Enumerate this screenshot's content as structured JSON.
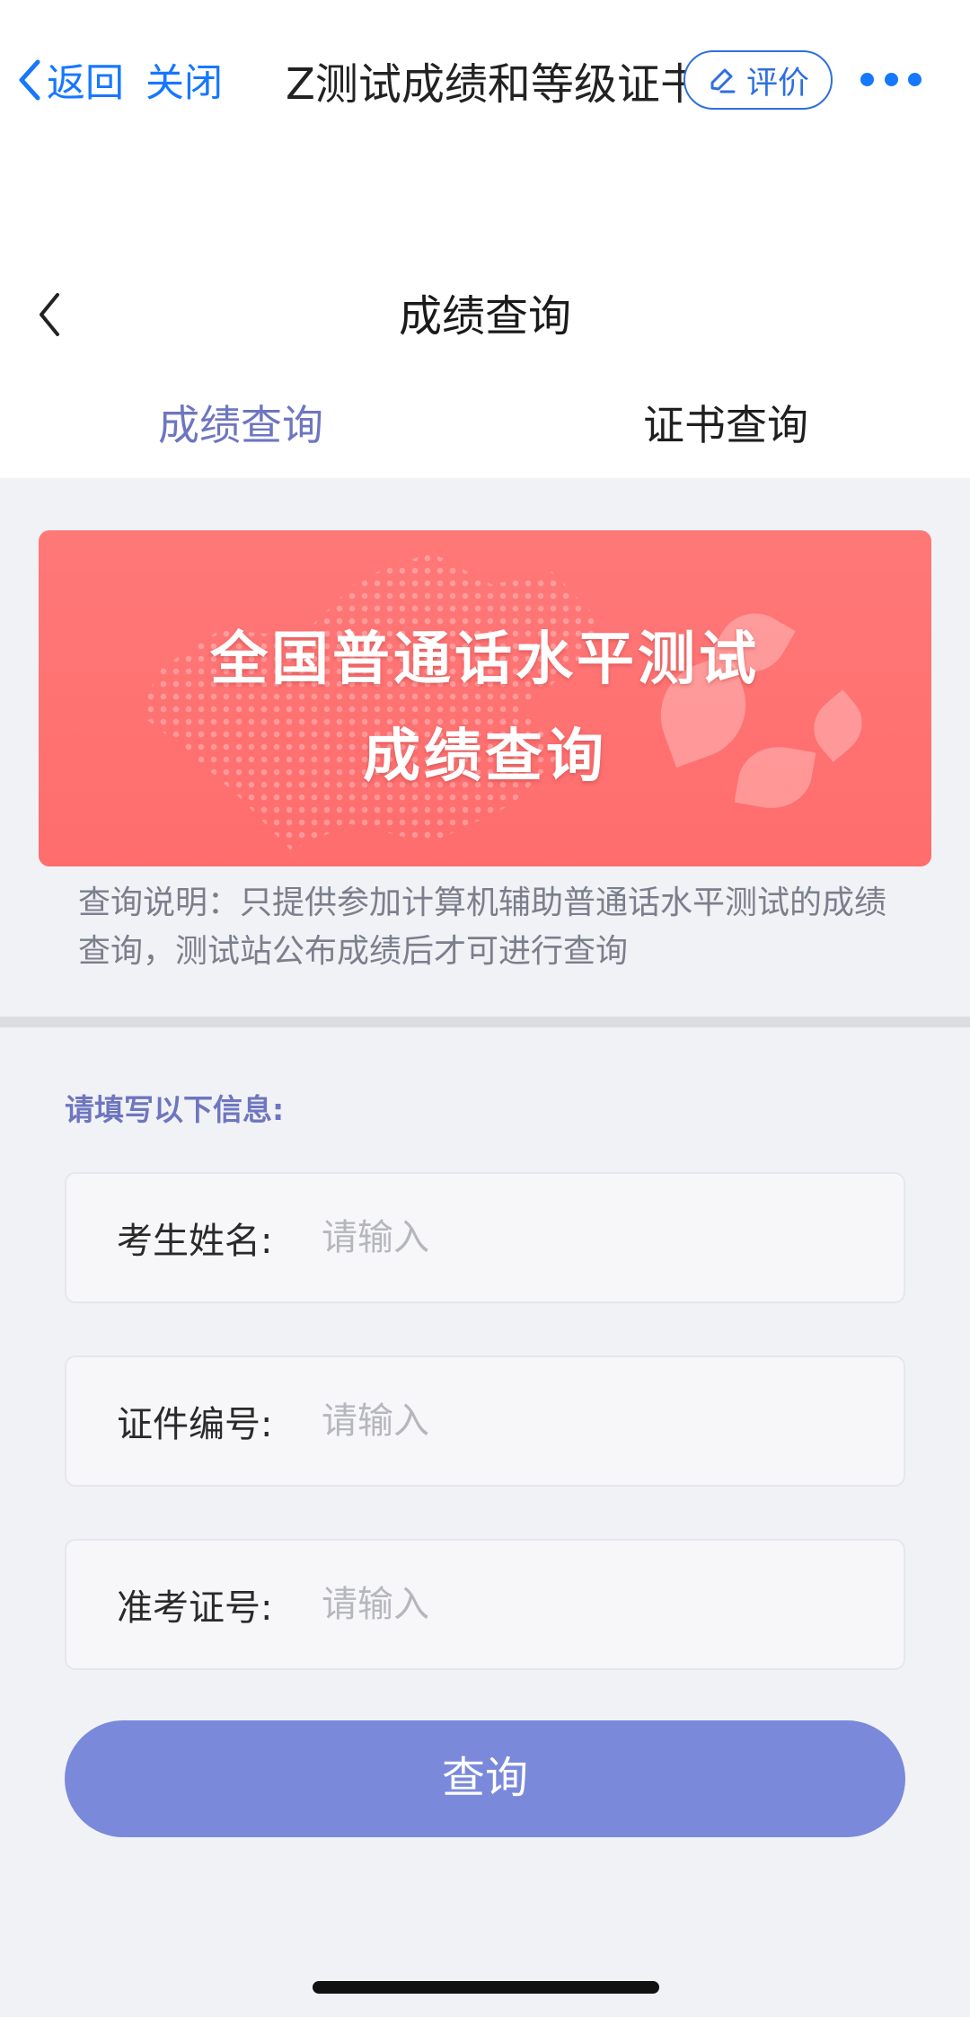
{
  "topbar": {
    "back_label": "返回",
    "close_label": "关闭",
    "mini_title": "Z测试成绩和等级证书",
    "eval_label": "评价",
    "accent_color": "#1677ff"
  },
  "header": {
    "title": "成绩查询"
  },
  "tabs": [
    {
      "label": "成绩查询",
      "active": true
    },
    {
      "label": "证书查询",
      "active": false
    }
  ],
  "banner": {
    "line1": "全国普通话水平测试",
    "line2": "成绩查询",
    "background_color": "#ff7272"
  },
  "notice": "查询说明：只提供参加计算机辅助普通话水平测试的成绩查询，测试站公布成绩后才可进行查询",
  "form": {
    "heading": "请填写以下信息:",
    "fields": [
      {
        "label": "考生姓名:",
        "placeholder": "请输入",
        "value": ""
      },
      {
        "label": "证件编号:",
        "placeholder": "请输入",
        "value": ""
      },
      {
        "label": "准考证号:",
        "placeholder": "请输入",
        "value": ""
      }
    ],
    "submit_label": "查询",
    "submit_color": "#7b89db"
  }
}
